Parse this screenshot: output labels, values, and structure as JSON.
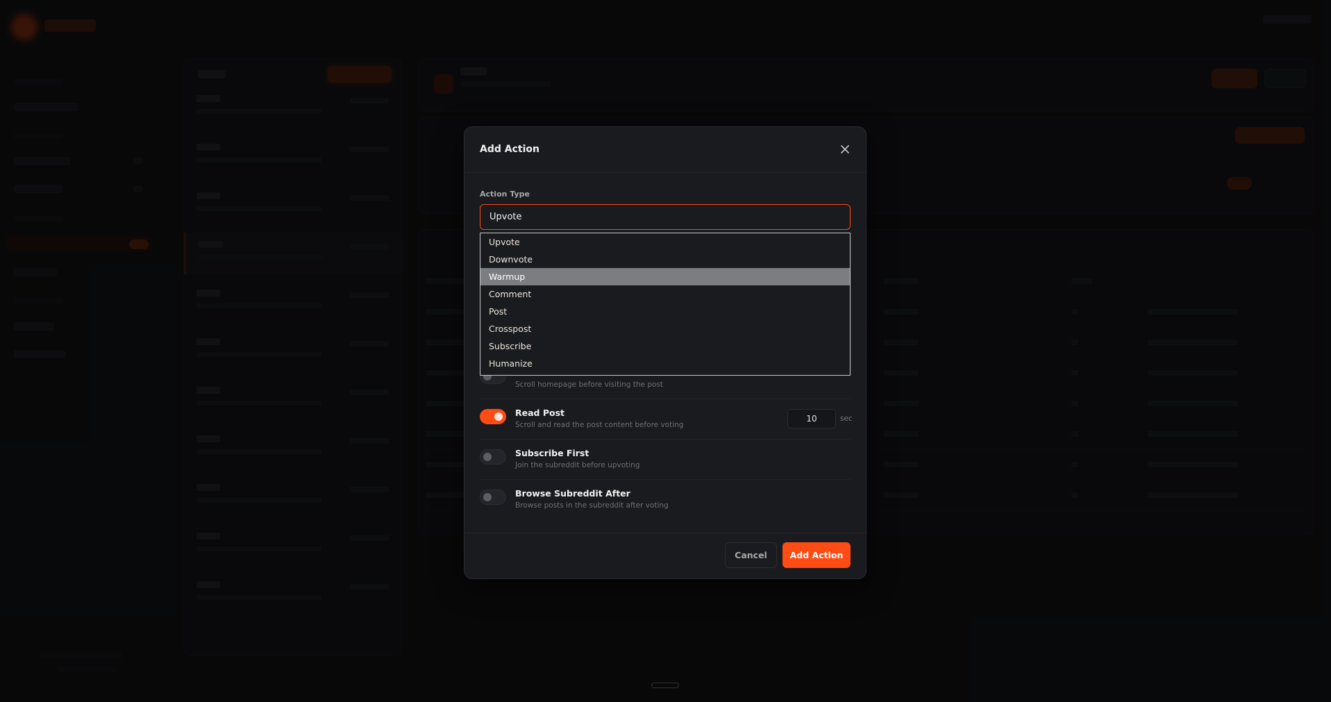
{
  "modal": {
    "title": "Add Action",
    "close_icon": "close-icon",
    "action_type_label": "Action Type",
    "selected_value": "Upvote",
    "options": [
      "Upvote",
      "Downvote",
      "Warmup",
      "Comment",
      "Post",
      "Crosspost",
      "Subscribe",
      "Humanize"
    ],
    "highlighted_option": "Warmup",
    "settings": [
      {
        "title": "",
        "description": "Scroll homepage before visiting the post",
        "enabled": false
      },
      {
        "title": "Read Post",
        "description": "Scroll and read the post content before voting",
        "enabled": true,
        "value": "10",
        "unit": "sec"
      },
      {
        "title": "Subscribe First",
        "description": "Join the subreddit before upvoting",
        "enabled": false
      },
      {
        "title": "Browse Subreddit After",
        "description": "Browse posts in the subreddit after voting",
        "enabled": false
      }
    ],
    "cancel_label": "Cancel",
    "submit_label": "Add Action"
  },
  "colors": {
    "accent": "#ff4b14",
    "modal_bg": "#1a1b1e",
    "page_bg": "#121316"
  }
}
